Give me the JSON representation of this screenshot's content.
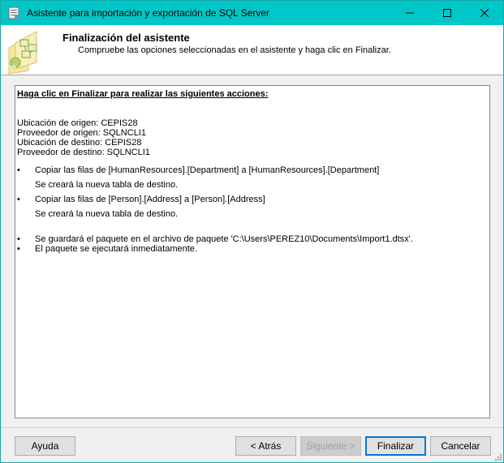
{
  "window": {
    "title": "Asistente para importación y exportación de SQL Server",
    "title_color": "#00c7c7"
  },
  "header": {
    "title": "Finalización del asistente",
    "subtitle": "Compruebe las opciones seleccionadas en el asistente y haga clic en Finalizar."
  },
  "report": {
    "heading": "Haga clic en Finalizar para realizar las siguientes acciones:",
    "source_location": "Ubicación de origen: CEPIS28",
    "source_provider": "Proveedor de origen: SQLNCLI1",
    "dest_location": "Ubicación de destino: CEPIS28",
    "dest_provider": "Proveedor de destino: SQLNCLI1",
    "bullet": "•",
    "actions": [
      {
        "text": "Copiar las filas de [HumanResources].[Department] a [HumanResources].[Department]",
        "note": "Se creará la nueva tabla de destino."
      },
      {
        "text": "Copiar las filas de [Person].[Address] a [Person].[Address]",
        "note": "Se creará la nueva tabla de destino."
      }
    ],
    "save_package": "Se guardará el paquete en el archivo de paquete 'C:\\Users\\PEREZ10\\Documents\\Import1.dtsx'.",
    "execute_now": "El paquete se ejecutará inmediatamente."
  },
  "buttons": {
    "help": "Ayuda",
    "back": "< Atrás",
    "next": "Siguiente >",
    "finish": "Finalizar",
    "cancel": "Cancelar"
  },
  "icons": {
    "app": "sql-wizard-app-icon",
    "wizard": "wizard-header-icon",
    "minimize": "minimize-icon",
    "maximize": "maximize-icon",
    "close": "close-icon"
  }
}
